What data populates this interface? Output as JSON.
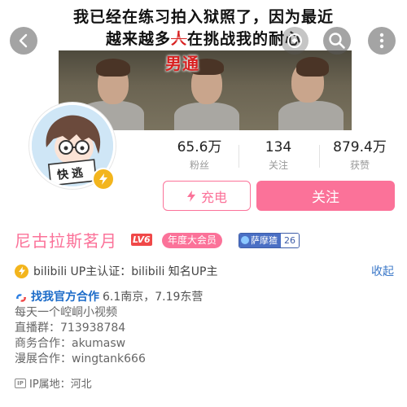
{
  "banner": {
    "caption_line1": "我已经在练习拍入狱照了，因为最近",
    "caption_line2_pre": "越来越多",
    "caption_line2_strike": "人",
    "caption_line2_post": "在挑战我的耐心",
    "caption_red": "男通"
  },
  "icons": {
    "back": "back-arrow-icon",
    "extra": "circle-action-icon",
    "search": "search-icon",
    "more": "more-vertical-icon",
    "charge": "lightning-icon",
    "auth": "lightning-badge-icon",
    "coop": "cooperation-icon",
    "ip": "ip-icon"
  },
  "avatar": {
    "sign_text": "快逃",
    "level_badge": "lightning-badge-icon"
  },
  "stats": [
    {
      "value": "65.6万",
      "label": "粉丝"
    },
    {
      "value": "134",
      "label": "关注"
    },
    {
      "value": "879.4万",
      "label": "获赞"
    }
  ],
  "actions": {
    "charge_label": "充电",
    "follow_label": "关注"
  },
  "profile": {
    "name": "尼古拉斯茗月",
    "level": "LV6",
    "vip_badge": "年度大会员",
    "medal_name": "萨摩猹",
    "medal_level": "26"
  },
  "auth": {
    "text": "bilibili UP主认证：bilibili 知名UP主",
    "collapse_label": "收起"
  },
  "bio": {
    "coop_label": "找我官方合作",
    "coop_rest": "6.1南京，7.19东营",
    "lines": [
      "每天一个崆峒小视频",
      "直播群：713938784",
      "商务合作：akumasw",
      "漫展合作：wingtank666"
    ]
  },
  "ip": {
    "tag": "IP",
    "label": "IP属地：河北"
  },
  "colors": {
    "accent_pink": "#fb7299",
    "link_blue": "#3b78c8",
    "gold": "#f3b51d"
  }
}
